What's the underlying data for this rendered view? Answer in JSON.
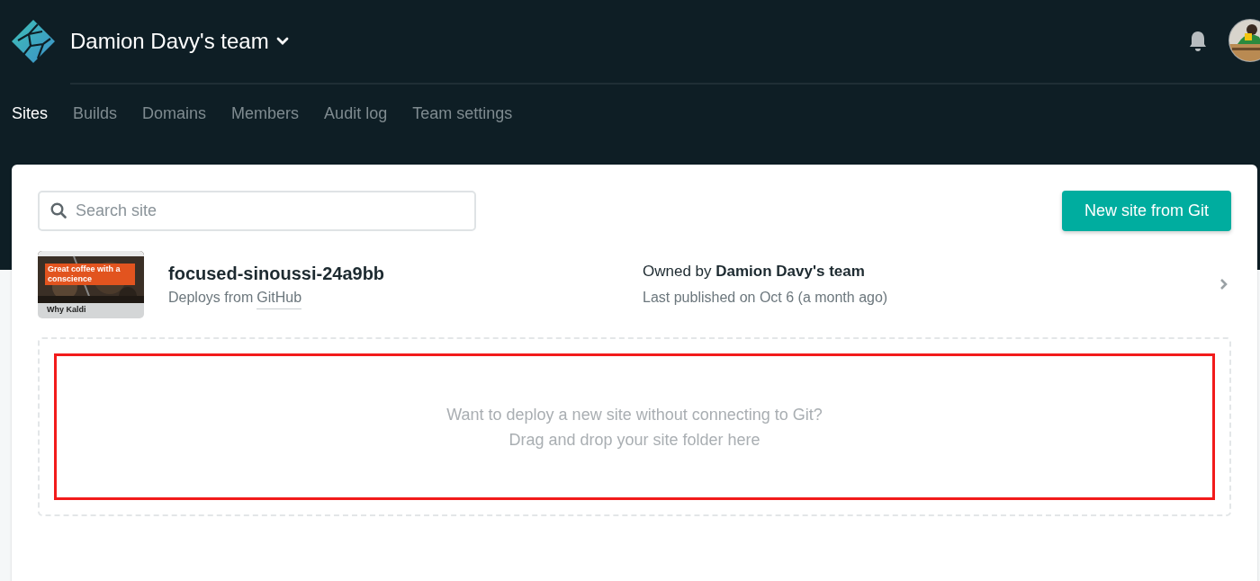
{
  "header": {
    "team_name": "Damion Davy's team"
  },
  "tabs": [
    {
      "label": "Sites",
      "selected": true
    },
    {
      "label": "Builds",
      "selected": false
    },
    {
      "label": "Domains",
      "selected": false
    },
    {
      "label": "Members",
      "selected": false
    },
    {
      "label": "Audit log",
      "selected": false
    },
    {
      "label": "Team settings",
      "selected": false
    }
  ],
  "search": {
    "placeholder": "Search site"
  },
  "new_site_button": "New site from Git",
  "sites": [
    {
      "name": "focused-sinoussi-24a9bb",
      "deploy_prefix": "Deploys from ",
      "deploy_source": "GitHub",
      "owner_prefix": "Owned by ",
      "owner": "Damion Davy's team",
      "published": "Last published on Oct 6 (a month ago)",
      "thumbnail": {
        "headline": "Great coffee with a conscience",
        "footer": "Why Kaldi"
      }
    }
  ],
  "dropzone": {
    "lines": [
      "Want to deploy a new site without connecting to Git?",
      "Drag and drop your site folder here"
    ],
    "highlighted": true
  }
}
